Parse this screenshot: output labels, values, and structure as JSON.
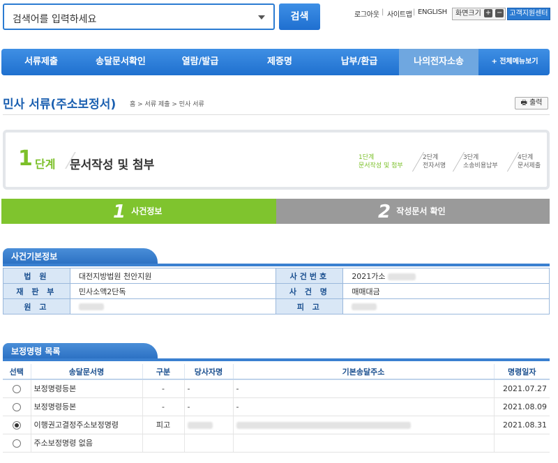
{
  "header": {
    "search_placeholder": "검색어를 입력하세요",
    "search_button": "검색",
    "util_links": [
      "로그아웃",
      "사이트맵",
      "ENGLISH"
    ],
    "zoom_label": "화면크기",
    "zoom_plus": "+",
    "zoom_minus": "−",
    "support_label": "고객지원센터"
  },
  "nav": {
    "items": [
      "서류제출",
      "송달문서확인",
      "열람/발급",
      "제증명",
      "납부/환급",
      "나의전자소송"
    ],
    "active_index": 5,
    "all_menu": "+ 전체메뉴보기"
  },
  "page": {
    "title": "민사 서류(주소보정서)",
    "breadcrumb": "홈 > 서류 제출 > 민사 서류",
    "print_label": "출력"
  },
  "step": {
    "number": "1",
    "word": "단계",
    "desc": "문서작성 및 첨부",
    "substeps": [
      {
        "top": "1단계",
        "bottom": "문서작성 및 첨부"
      },
      {
        "top": "2단계",
        "bottom": "전자서명"
      },
      {
        "top": "3단계",
        "bottom": "소송비용납부"
      },
      {
        "top": "4단계",
        "bottom": "문서제출"
      }
    ]
  },
  "tabs": [
    {
      "num": "1",
      "label": "사건정보"
    },
    {
      "num": "2",
      "label": "작성문서 확인"
    }
  ],
  "case_info": {
    "section_title": "사건기본정보",
    "rows": [
      {
        "h1": "법 원",
        "v1": "대전지방법원 천안지원",
        "h2": "사건번호",
        "v2": "2021가소"
      },
      {
        "h1": "재 판 부",
        "v1": "민사소액2단독",
        "h2": "사 건 명",
        "v2": "매매대금"
      },
      {
        "h1": "원 고",
        "v1": "",
        "h2": "피 고",
        "v2": ""
      }
    ]
  },
  "orders": {
    "section_title": "보정명령 목록",
    "columns": [
      "선택",
      "송달문서명",
      "구분",
      "당사자명",
      "기본송달주소",
      "명령일자"
    ],
    "rows": [
      {
        "selected": false,
        "name": "보정명령등본",
        "type": "-",
        "party": "-",
        "address": "-",
        "date": "2021.07.27"
      },
      {
        "selected": false,
        "name": "보정명령등본",
        "type": "-",
        "party": "-",
        "address": "-",
        "date": "2021.08.09"
      },
      {
        "selected": true,
        "name": "이행권고결정주소보정명령",
        "type": "피고",
        "party": "",
        "address": "",
        "date": "2021.08.31"
      },
      {
        "selected": false,
        "name": "주소보정명령 없음",
        "type": "",
        "party": "",
        "address": "",
        "date": ""
      }
    ]
  }
}
